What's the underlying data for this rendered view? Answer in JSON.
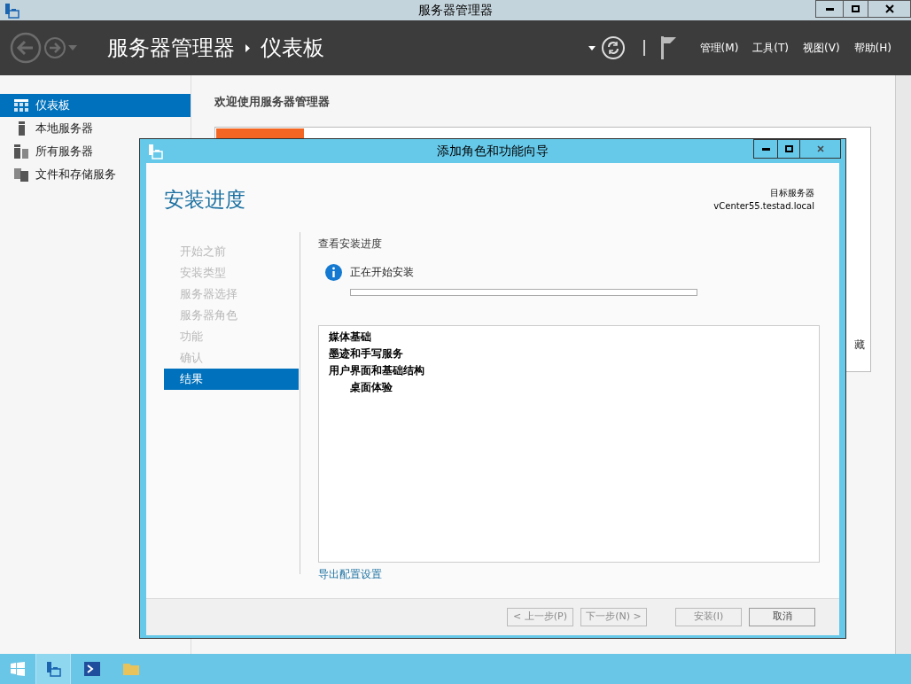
{
  "window": {
    "title": "服务器管理器"
  },
  "header": {
    "breadcrumb": [
      {
        "text": "服务器管理器"
      },
      {
        "text": "仪表板"
      }
    ],
    "menus": [
      "管理(M)",
      "工具(T)",
      "视图(V)",
      "帮助(H)"
    ]
  },
  "sidebar": {
    "items": [
      {
        "label": "仪表板",
        "kind": "dashboard",
        "selected": true
      },
      {
        "label": "本地服务器",
        "kind": "server",
        "selected": false
      },
      {
        "label": "所有服务器",
        "kind": "servers",
        "selected": false
      },
      {
        "label": "文件和存储服务",
        "kind": "files",
        "selected": false
      }
    ]
  },
  "content": {
    "welcome": "欢迎使用服务器管理器",
    "hidden_fragment": "藏"
  },
  "dialog": {
    "title": "添加角色和功能向导",
    "heading": "安装进度",
    "target_label": "目标服务器",
    "target_server": "vCenter55.testad.local",
    "steps": [
      {
        "label": "开始之前",
        "selected": false
      },
      {
        "label": "安装类型",
        "selected": false
      },
      {
        "label": "服务器选择",
        "selected": false
      },
      {
        "label": "服务器角色",
        "selected": false
      },
      {
        "label": "功能",
        "selected": false
      },
      {
        "label": "确认",
        "selected": false
      },
      {
        "label": "结果",
        "selected": true
      }
    ],
    "section_title": "查看安装进度",
    "status": "正在开始安装",
    "progress": {
      "level": 0
    },
    "features": [
      {
        "label": "媒体基础"
      },
      {
        "label": "墨迹和手写服务"
      },
      {
        "label": "用户界面和基础结构",
        "children": [
          {
            "label": "桌面体验"
          }
        ]
      }
    ],
    "export_link": "导出配置设置",
    "buttons": [
      {
        "label": "< 上一步(P)",
        "disabled": true
      },
      {
        "label": "下一步(N) >",
        "disabled": true
      },
      {
        "label": "安装(I)",
        "disabled": true
      },
      {
        "label": "取消",
        "disabled": false
      }
    ]
  }
}
